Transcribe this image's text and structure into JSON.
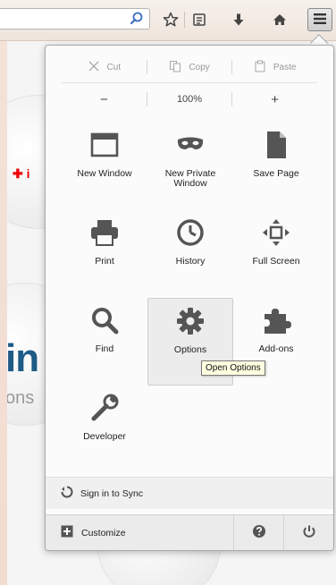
{
  "toolbar": {
    "search_placeholder": "",
    "icons": [
      "search-icon",
      "bookmark-star-icon",
      "reading-list-icon",
      "download-icon",
      "home-icon",
      "menu-icon"
    ]
  },
  "menu": {
    "edit": {
      "cut": "Cut",
      "copy": "Copy",
      "paste": "Paste"
    },
    "zoom": {
      "minus": "−",
      "level": "100%",
      "plus": "+"
    },
    "items": [
      {
        "label": "New Window",
        "icon": "new-window-icon"
      },
      {
        "label": "New Private Window",
        "icon": "private-mask-icon"
      },
      {
        "label": "Save Page",
        "icon": "save-page-icon"
      },
      {
        "label": "Print",
        "icon": "printer-icon"
      },
      {
        "label": "History",
        "icon": "clock-icon"
      },
      {
        "label": "Full Screen",
        "icon": "fullscreen-icon"
      },
      {
        "label": "Find",
        "icon": "magnifier-icon"
      },
      {
        "label": "Options",
        "icon": "gear-icon"
      },
      {
        "label": "Add-ons",
        "icon": "puzzle-icon"
      },
      {
        "label": "Developer",
        "icon": "wrench-icon"
      }
    ],
    "tooltip": "Open Options",
    "sync_label": "Sign in to Sync",
    "customize_label": "Customize"
  },
  "colors": {
    "panel_bg": "#fbfbfb",
    "icon_gray": "#555555",
    "accent_blue": "#1e5b86",
    "tooltip_bg": "#ffffe1"
  }
}
